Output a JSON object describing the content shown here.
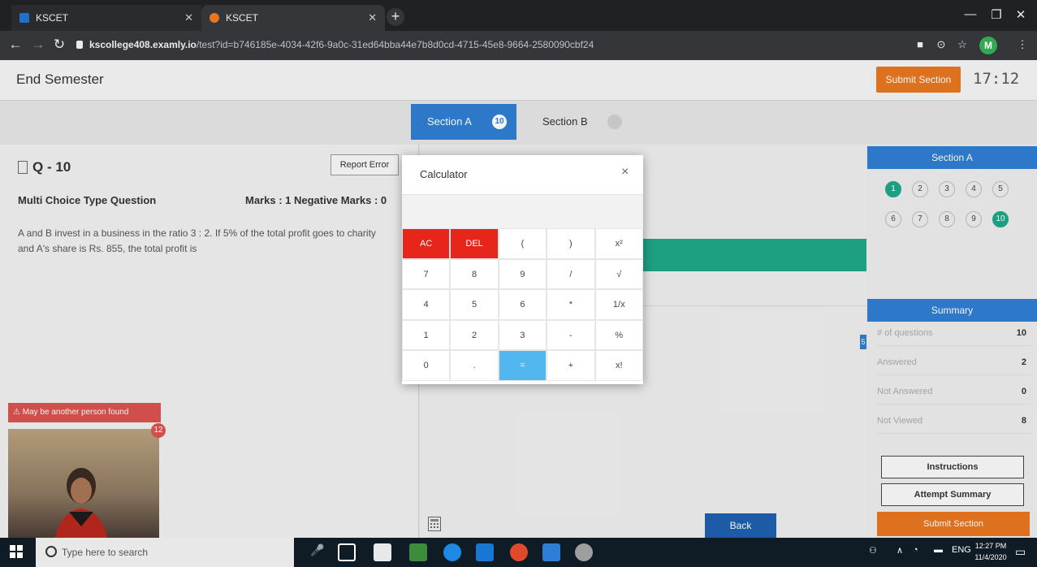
{
  "browser": {
    "tabs": [
      {
        "title": "KSCET",
        "favicon_color": "#1f6fd1"
      },
      {
        "title": "KSCET",
        "favicon_color": "#e8761f"
      }
    ],
    "url_host": "kscollege408.examly.io",
    "url_path": "/test?id=b746185e-4034-42f6-9a0c-31ed64bba44e7b8d0cd-4715-45e8-9664-2580090cbf24",
    "profile_initial": "M"
  },
  "header": {
    "exam_title": "End Semester",
    "submit_label": "Submit Section",
    "timer": "17:12"
  },
  "sections": [
    {
      "label": "Section A",
      "count": "10"
    },
    {
      "label": "Section B",
      "count": ""
    }
  ],
  "question": {
    "number_label": "Q - 10",
    "report_label": "Report Error",
    "type_label": "Multi Choice Type Question",
    "marks_label": "Marks : 1  Negative Marks : 0",
    "text": "A and B invest in a business in the ratio 3 : 2. If 5% of the total profit goes to charity and A's share is Rs. 855, the total profit is"
  },
  "proctor": {
    "warning": "May be another person found",
    "badge_count": "12"
  },
  "calculator": {
    "title": "Calculator",
    "close": "×",
    "display": "",
    "keys": [
      {
        "label": "AC",
        "style": "red"
      },
      {
        "label": "DEL",
        "style": "red"
      },
      {
        "label": "(",
        "style": ""
      },
      {
        "label": ")",
        "style": ""
      },
      {
        "label": "x²",
        "style": ""
      },
      {
        "label": "7",
        "style": ""
      },
      {
        "label": "8",
        "style": ""
      },
      {
        "label": "9",
        "style": ""
      },
      {
        "label": "/",
        "style": ""
      },
      {
        "label": "√",
        "style": ""
      },
      {
        "label": "4",
        "style": ""
      },
      {
        "label": "5",
        "style": ""
      },
      {
        "label": "6",
        "style": ""
      },
      {
        "label": "*",
        "style": ""
      },
      {
        "label": "1/x",
        "style": ""
      },
      {
        "label": "1",
        "style": ""
      },
      {
        "label": "2",
        "style": ""
      },
      {
        "label": "3",
        "style": ""
      },
      {
        "label": "-",
        "style": ""
      },
      {
        "label": "%",
        "style": ""
      },
      {
        "label": "0",
        "style": ""
      },
      {
        "label": ".",
        "style": ""
      },
      {
        "label": "=",
        "style": "blue"
      },
      {
        "label": "+",
        "style": ""
      },
      {
        "label": "x!",
        "style": ""
      }
    ]
  },
  "middle": {
    "back_label": "Back",
    "scroll_tab": "5"
  },
  "sidebar": {
    "section_title": "Section A",
    "questions": [
      {
        "n": "1",
        "answered": true
      },
      {
        "n": "2",
        "answered": false
      },
      {
        "n": "3",
        "answered": false
      },
      {
        "n": "4",
        "answered": false
      },
      {
        "n": "5",
        "answered": false
      },
      {
        "n": "6",
        "answered": false
      },
      {
        "n": "7",
        "answered": false
      },
      {
        "n": "8",
        "answered": false
      },
      {
        "n": "9",
        "answered": false
      },
      {
        "n": "10",
        "answered": true
      }
    ],
    "summary_title": "Summary",
    "summary": [
      {
        "label": "# of questions",
        "value": "10"
      },
      {
        "label": "Answered",
        "value": "2"
      },
      {
        "label": "Not Answered",
        "value": "0"
      },
      {
        "label": "Not Viewed",
        "value": "8"
      }
    ],
    "instructions_label": "Instructions",
    "attempt_summary_label": "Attempt Summary",
    "submit_label": "Submit Section"
  },
  "taskbar": {
    "search_placeholder": "Type here to search",
    "time": "12:27 PM",
    "date": "11/4/2020",
    "lang": "ENG"
  },
  "colors": {
    "accent": "#2f7dd1",
    "submit": "#e8761f",
    "answered": "#1fa687",
    "danger": "#e8251a"
  }
}
